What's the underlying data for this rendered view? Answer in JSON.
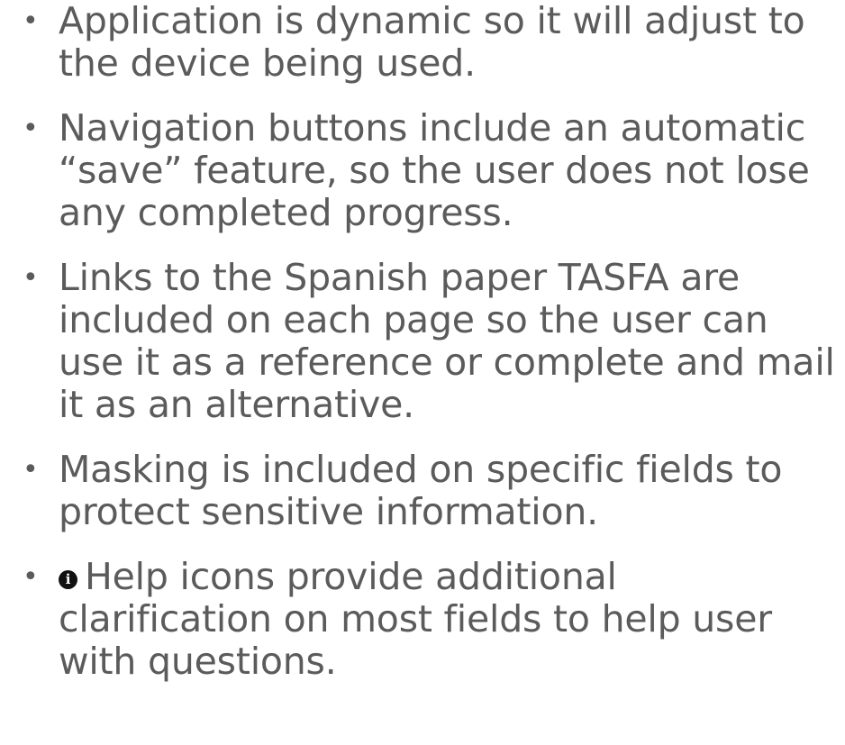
{
  "bullets": [
    {
      "text": "Application is dynamic so it will adjust to the device being used."
    },
    {
      "text": "Navigation buttons include an automatic “save” feature, so the user does not lose any completed progress."
    },
    {
      "text": "Links to the Spanish paper TASFA are included on each page so the user can use it as a reference or complete and mail it as an alternative."
    },
    {
      "text": "Masking is included on specific fields to protect sensitive information."
    },
    {
      "text": "Help icons provide additional clarification on most fields to help user with questions.",
      "icon": "info-icon"
    }
  ]
}
